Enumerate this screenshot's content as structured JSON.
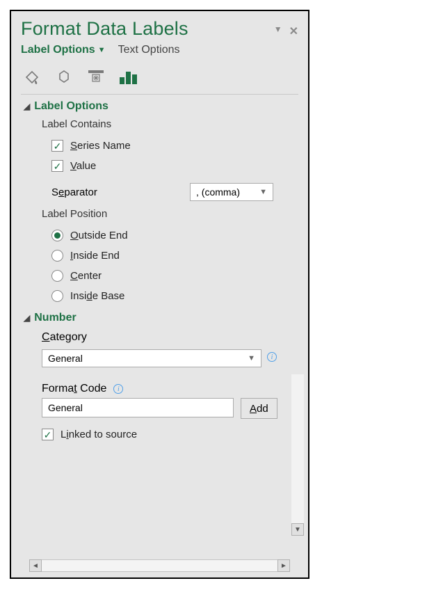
{
  "title": "Format Data Labels",
  "tabs": {
    "label_options": "Label Options",
    "text_options": "Text Options"
  },
  "icons": {
    "fill": "fill-line-icon",
    "effects": "effects-icon",
    "size": "size-properties-icon",
    "options": "label-options-icon"
  },
  "sections": {
    "label_options": {
      "title": "Label Options",
      "label_contains": "Label Contains",
      "series_name": "Series Name",
      "series_name_checked": true,
      "value": "Value",
      "value_checked": true,
      "separator_label": "Separator",
      "separator_value": ", (comma)",
      "label_position": "Label Position",
      "positions": {
        "outside_end": "Outside End",
        "inside_end": "Inside End",
        "center": "Center",
        "inside_base": "Inside Base"
      },
      "position_selected": "outside_end"
    },
    "number": {
      "title": "Number",
      "category_label": "Category",
      "category_value": "General",
      "format_code_label": "Format Code",
      "format_code_value": "General",
      "add_button": "Add",
      "linked_label": "Linked to source",
      "linked_checked": true
    }
  }
}
